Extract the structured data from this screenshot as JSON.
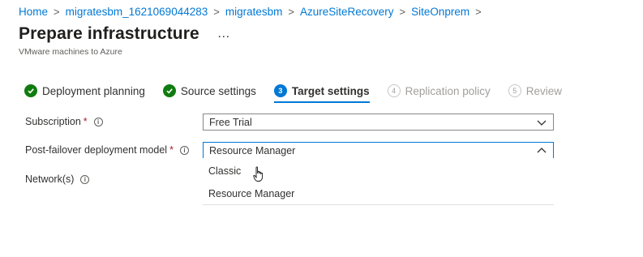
{
  "breadcrumb": [
    "Home",
    "migratesbm_1621069044283",
    "migratesbm",
    "AzureSiteRecovery",
    "SiteOnprem"
  ],
  "page": {
    "title": "Prepare infrastructure",
    "more": "…",
    "subtitle": "VMware machines to Azure"
  },
  "steps": [
    {
      "label": "Deployment planning",
      "state": "done",
      "icon": "check-circle-icon"
    },
    {
      "label": "Source settings",
      "state": "done",
      "icon": "check-circle-icon"
    },
    {
      "number": "3",
      "label": "Target settings",
      "state": "active"
    },
    {
      "number": "4",
      "label": "Replication policy",
      "state": "disabled"
    },
    {
      "number": "5",
      "label": "Review",
      "state": "disabled"
    }
  ],
  "form": {
    "subscription": {
      "label": "Subscription",
      "required": "*",
      "value": "Free Trial"
    },
    "deployment_model": {
      "label": "Post-failover deployment model",
      "required": "*",
      "value": "Resource Manager"
    },
    "network": {
      "label": "Network(s)"
    }
  },
  "dropdown": {
    "options": [
      "Classic",
      "Resource Manager"
    ]
  },
  "colors": {
    "link": "#0078d4",
    "success": "#107c10",
    "required": "#a4262c"
  }
}
